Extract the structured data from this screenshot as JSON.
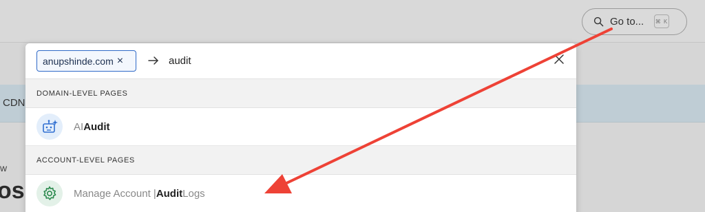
{
  "goto": {
    "label": "Go to...",
    "shortcut": "⌘ K"
  },
  "background": {
    "banner_text": "CDN",
    "small_text": "w",
    "big_text": "osh"
  },
  "search": {
    "domain_chip": "anupshinde.com",
    "chip_close": "×",
    "query": "audit"
  },
  "sections": [
    {
      "title": "DOMAIN-LEVEL PAGES",
      "items": [
        {
          "muted": "AI ",
          "strong": "Audit",
          "after": "",
          "icon": "robot-icon"
        }
      ]
    },
    {
      "title": "ACCOUNT-LEVEL PAGES",
      "items": [
        {
          "muted": "Manage Account | ",
          "strong": "Audit",
          "after": " Logs",
          "icon": "gear-icon"
        }
      ]
    }
  ],
  "colors": {
    "accent": "#2e69c7",
    "annotation_arrow": "#ee4236",
    "icon_blue": "#2f6fd1",
    "icon_green": "#2c8a4e"
  }
}
